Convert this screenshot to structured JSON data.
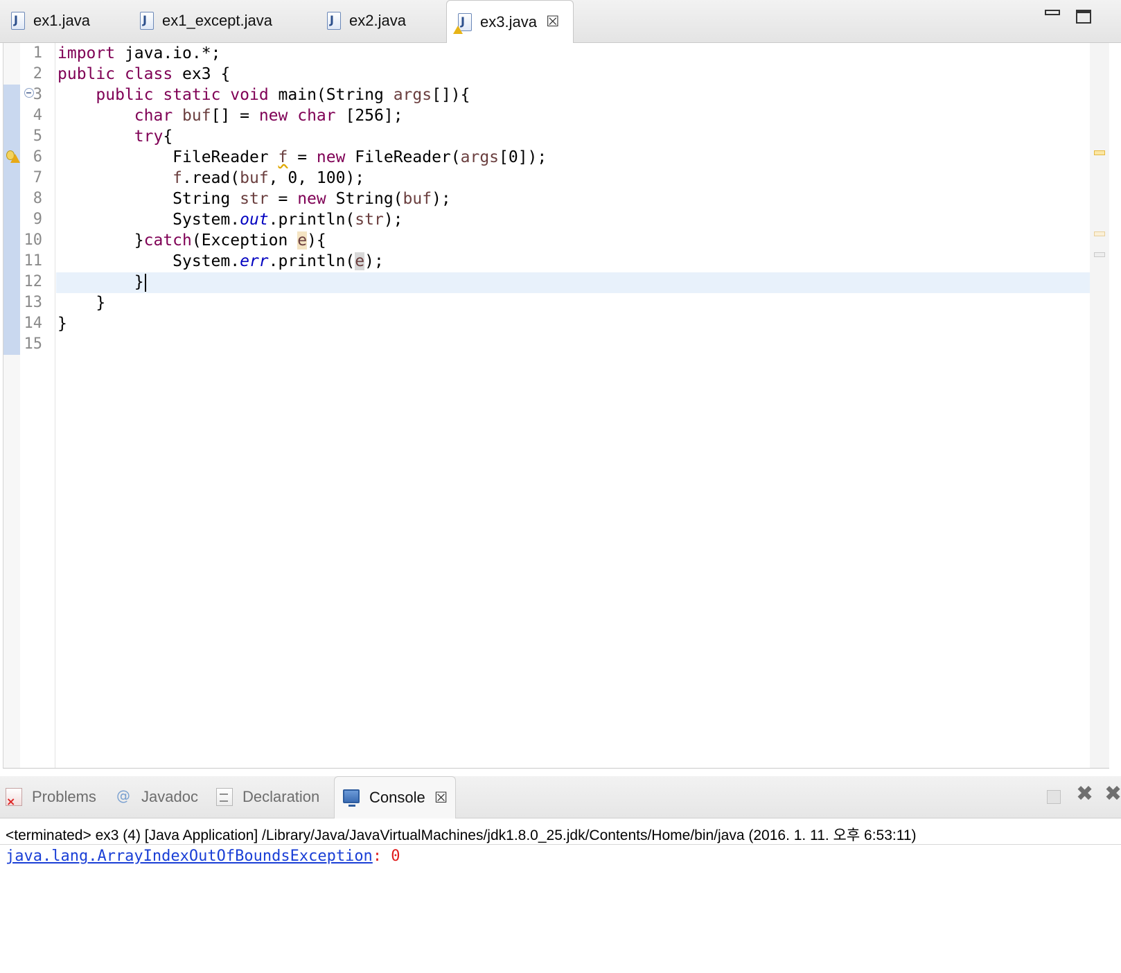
{
  "editor_tabs": [
    {
      "label": "ex1.java",
      "active": false
    },
    {
      "label": "ex1_except.java",
      "active": false
    },
    {
      "label": "ex2.java",
      "active": false
    },
    {
      "label": "ex3.java",
      "active": true,
      "warning": true
    }
  ],
  "editor": {
    "line_numbers": [
      "1",
      "2",
      "3",
      "4",
      "5",
      "6",
      "7",
      "8",
      "9",
      "10",
      "11",
      "12",
      "13",
      "14",
      "15"
    ],
    "code": {
      "l1_kw": "import",
      "l1_rest": " java.io.*;",
      "l2_kw1": "public",
      "l2_kw2": "class",
      "l2_rest": " ex3 {",
      "l3_indent": "    ",
      "l3_kw1": "public",
      "l3_kw2": "static",
      "l3_kw3": "void",
      "l3_mid": " main(String ",
      "l3_var": "args",
      "l3_end": "[]){",
      "l4_indent": "        ",
      "l4_kw1": "char",
      "l4_var": "buf",
      "l4_mid": "[] = ",
      "l4_kw2": "new",
      "l4_kw3": "char",
      "l4_end": " [256];",
      "l5_indent": "        ",
      "l5_kw": "try",
      "l5_end": "{",
      "l6_indent": "            ",
      "l6_a": "FileReader ",
      "l6_var": "f",
      "l6_b": " = ",
      "l6_kw": "new",
      "l6_c": " FileReader(",
      "l6_var2": "args",
      "l6_d": "[0]);",
      "l7_indent": "            ",
      "l7_var": "f",
      "l7_a": ".read(",
      "l7_var2": "buf",
      "l7_b": ", 0, 100);",
      "l8_indent": "            ",
      "l8_a": "String ",
      "l8_var": "str",
      "l8_b": " = ",
      "l8_kw": "new",
      "l8_c": " String(",
      "l8_var2": "buf",
      "l8_d": ");",
      "l9_indent": "            ",
      "l9_a": "System.",
      "l9_fld": "out",
      "l9_b": ".println(",
      "l9_var": "str",
      "l9_c": ");",
      "l10_indent": "        ",
      "l10_a": "}",
      "l10_kw": "catch",
      "l10_b": "(Exception ",
      "l10_var": "e",
      "l10_c": "){",
      "l11_indent": "            ",
      "l11_a": "System.",
      "l11_fld": "err",
      "l11_b": ".println(",
      "l11_var": "e",
      "l11_c": ");",
      "l12_indent": "        ",
      "l12_a": "}",
      "l13_indent": "    ",
      "l13_a": "}",
      "l14_a": "}"
    }
  },
  "panel_tabs": [
    {
      "label": "Problems",
      "icon": "problems-icon",
      "active": false
    },
    {
      "label": "Javadoc",
      "icon": "javadoc-icon",
      "active": false
    },
    {
      "label": "Declaration",
      "icon": "declaration-icon",
      "active": false
    },
    {
      "label": "Console",
      "icon": "console-icon",
      "active": true
    }
  ],
  "console": {
    "header": "<terminated> ex3 (4) [Java Application] /Library/Java/JavaVirtualMachines/jdk1.8.0_25.jdk/Contents/Home/bin/java (2016. 1. 11. 오후 6:53:11)",
    "exception_class": "java.lang.ArrayIndexOutOfBoundsException",
    "colon": ":",
    "exception_message": " 0"
  },
  "colors": {
    "keyword": "#7f0055",
    "local_variable": "#6a3e3e",
    "static_field": "#0000c0",
    "current_line": "#e8f1fb",
    "console_link": "#1a3fd6",
    "console_error": "#e01b1b",
    "warning": "#e7b416"
  }
}
